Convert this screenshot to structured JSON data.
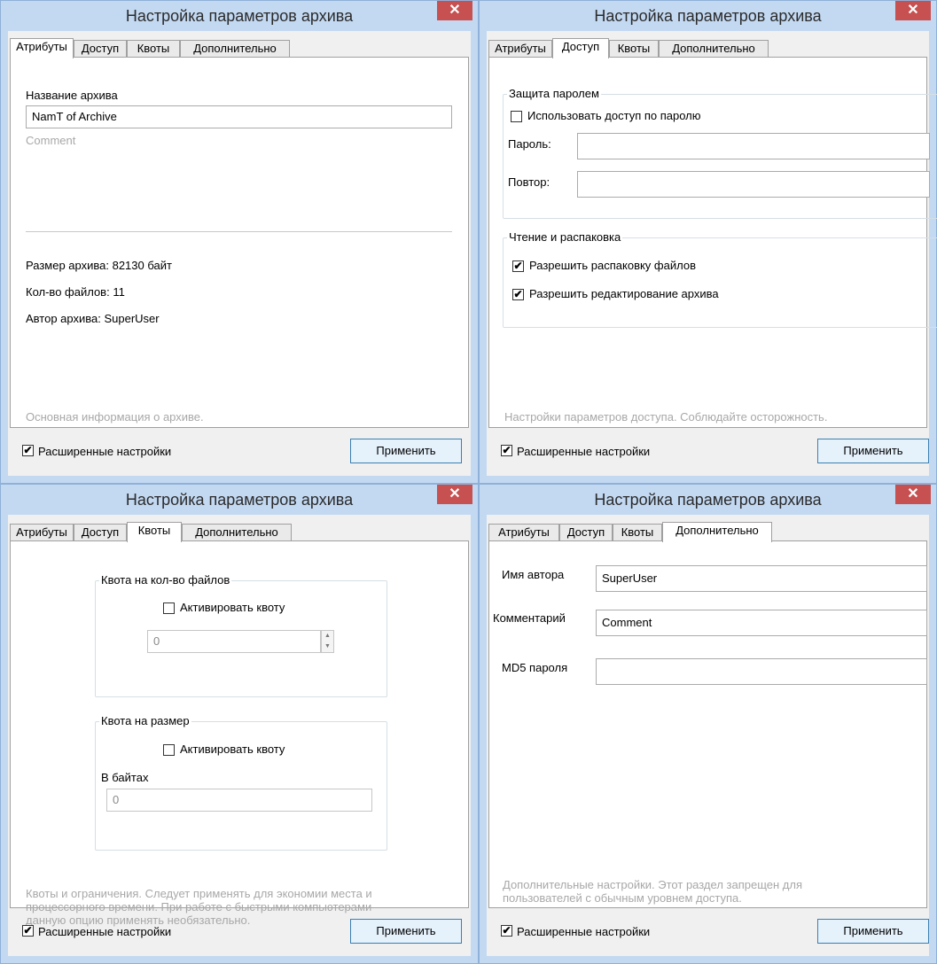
{
  "window_title": "Настройка параметров архива",
  "close_glyph": "✕",
  "check_glyph": "✔",
  "tabs": [
    "Атрибуты",
    "Доступ",
    "Квоты",
    "Дополнительно"
  ],
  "footer": {
    "advanced_label": "Расширенные настройки",
    "apply_label": "Применить"
  },
  "attributes": {
    "name_label": "Название архива",
    "name_value": "NamT of Archive",
    "comment": "Comment",
    "size": "Размер архива: 82130 байт",
    "files": "Кол-во файлов: 11",
    "author": "Автор архива: SuperUser",
    "hint": "Основная информация о архиве."
  },
  "access": {
    "password_group": "Защита паролем",
    "use_password": "Использовать доступ по паролю",
    "password_label": "Пароль:",
    "repeat_label": "Повтор:",
    "read_group": "Чтение и распаковка",
    "allow_extract": "Разрешить распаковку файлов",
    "allow_edit": "Разрешить редактирование архива",
    "hint": "Настройки параметров доступа. Соблюдайте осторожность."
  },
  "quotas": {
    "files_group": "Квота на кол-во файлов",
    "activate": "Активировать квоту",
    "files_value": "0",
    "size_group": "Квота на размер",
    "bytes_label": "В байтах",
    "size_value": "0",
    "hint_lines": [
      "Квоты и ограничения. Следует применять для экономии места и",
      "процессорного времени. При работе с быстрыми компьютерами",
      "данную опцию применять необязательно."
    ]
  },
  "extra": {
    "author_label": "Имя автора",
    "author_value": "SuperUser",
    "comment_label": "Комментарий",
    "comment_value": "Comment",
    "md5_label": "MD5 пароля",
    "md5_value": "",
    "hint_lines": [
      "Дополнительные настройки. Этот раздел запрещен для",
      "пользователей с обычным уровнем доступа."
    ]
  }
}
